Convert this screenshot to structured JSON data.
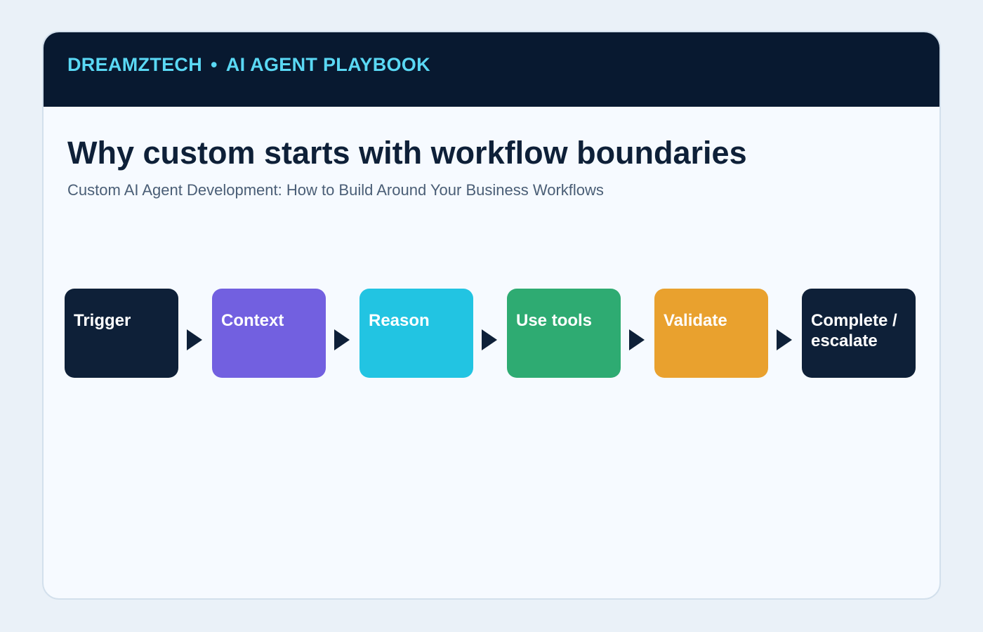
{
  "header": {
    "brand": "DREAMZTECH",
    "separator": "•",
    "section": "AI AGENT PLAYBOOK"
  },
  "content": {
    "title": "Why custom starts with workflow boundaries",
    "subtitle": "Custom AI Agent Development: How to Build Around Your Business Workflows"
  },
  "colors": {
    "banner": "#081930",
    "brand_text": "#5ad8f4",
    "arrow": "#0e2038"
  },
  "flow": {
    "steps": [
      {
        "label": "Trigger",
        "color": "#0e2038"
      },
      {
        "label": "Context",
        "color": "#7260e0"
      },
      {
        "label": "Reason",
        "color": "#22c4e2"
      },
      {
        "label": "Use tools",
        "color": "#2eab72"
      },
      {
        "label": "Validate",
        "color": "#e9a12e"
      },
      {
        "label": "Complete / escalate",
        "color": "#0e2038"
      }
    ]
  }
}
